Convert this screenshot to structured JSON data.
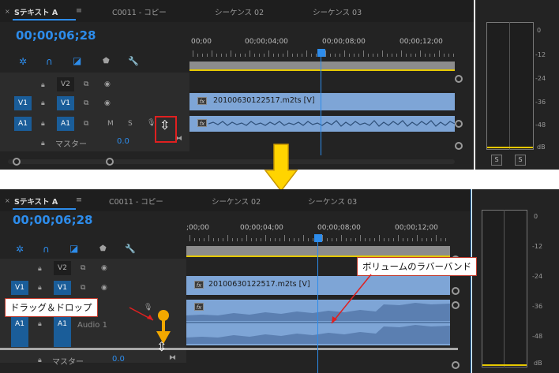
{
  "tabs": {
    "sequence_a": "Sテキスト A",
    "menu": "≡",
    "c0011": "C0011 - コピー",
    "seq02": "シーケンス 02",
    "seq03": "シーケンス 03",
    "close": "×"
  },
  "timecode": "00;00;06;28",
  "ruler": [
    "00;00",
    "00;00;04;00",
    "00;00;08;00",
    "00;00;12;00"
  ],
  "ruler_bottom": [
    ";00;00",
    "00;00;04;00",
    "00;00;08;00",
    "00;00;12;00"
  ],
  "tracks": {
    "v2": "V2",
    "v1_source": "V1",
    "v1": "V1",
    "a1_source": "A1",
    "a1": "A1",
    "mute": "M",
    "solo": "S",
    "master_label": "マスター",
    "master_value": "0.0",
    "audio1_name": "Audio 1"
  },
  "clip": {
    "video_name": "20100630122517.m2ts [V]",
    "fx": "fx"
  },
  "meter": {
    "ticks": [
      "0",
      "-12",
      "-24",
      "-36",
      "-48",
      "dB"
    ],
    "solo_left": "S",
    "solo_right": "S"
  },
  "callouts": {
    "drag_drop": "ドラッグ＆ドロップ",
    "rubber_band": "ボリュームのラバーバンド"
  },
  "colors": {
    "accent_blue": "#2d8ceb",
    "active_track": "#1a5d99",
    "clip": "#7ea5d6",
    "highlight": "#e02020",
    "arrow": "#ffd400"
  }
}
